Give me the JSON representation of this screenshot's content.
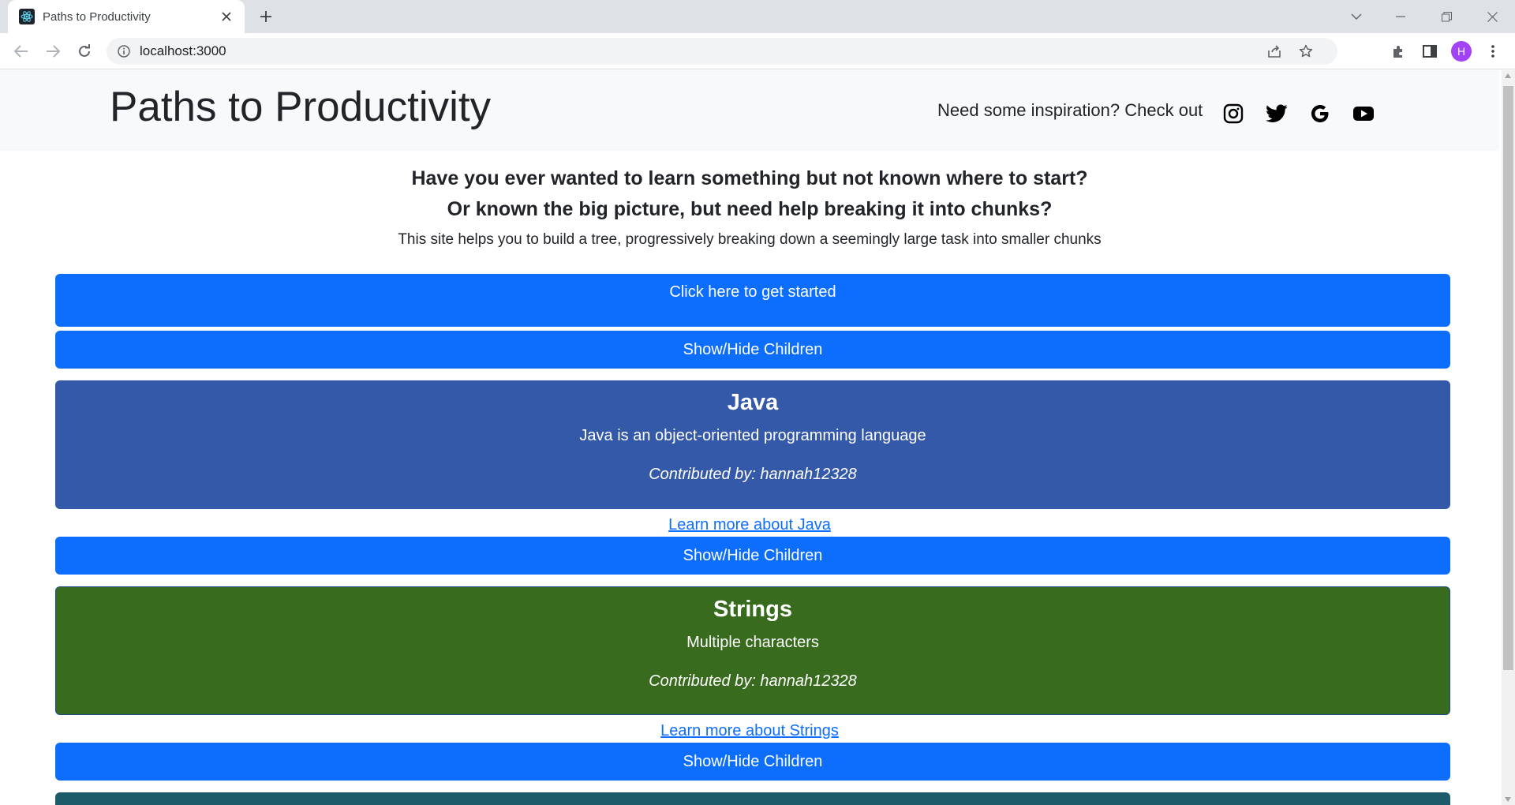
{
  "browser": {
    "tab_title": "Paths to Productivity",
    "url": "localhost:3000",
    "profile_initial": "H",
    "icons": [
      "react-favicon-icon",
      "close-icon",
      "plus-icon",
      "chevron-down-icon",
      "minimize-icon",
      "restore-icon",
      "window-close-icon",
      "back-arrow-icon",
      "forward-arrow-icon",
      "reload-icon",
      "info-icon",
      "share-icon",
      "star-icon",
      "extensions-icon",
      "side-panel-icon",
      "more-vert-icon"
    ]
  },
  "header": {
    "title": "Paths to Productivity",
    "inspiration_text": "Need some inspiration? Check out",
    "social_icons": [
      "instagram-icon",
      "twitter-icon",
      "google-icon",
      "youtube-icon"
    ]
  },
  "intro": {
    "line1": "Have you ever wanted to learn something but not known where to start?",
    "line2": "Or known the big picture, but need help breaking it into chunks?",
    "description": "This site helps you to build a tree, progressively breaking down a seemingly large task into smaller chunks"
  },
  "get_started_label": "Click here to get started",
  "toggle_label": "Show/Hide Children",
  "nodes": [
    {
      "title": "Java",
      "description": "Java is an object-oriented programming language",
      "contributor": "Contributed by: hannah12328",
      "learn_more": "Learn more about Java",
      "color": "#3559a9"
    },
    {
      "title": "Strings",
      "description": "Multiple characters",
      "contributor": "Contributed by: hannah12328",
      "learn_more": "Learn more about Strings",
      "color": "#386b1e"
    }
  ],
  "colors": {
    "primary": "#0d6efd",
    "third_node_color": "#1d5a6a"
  }
}
